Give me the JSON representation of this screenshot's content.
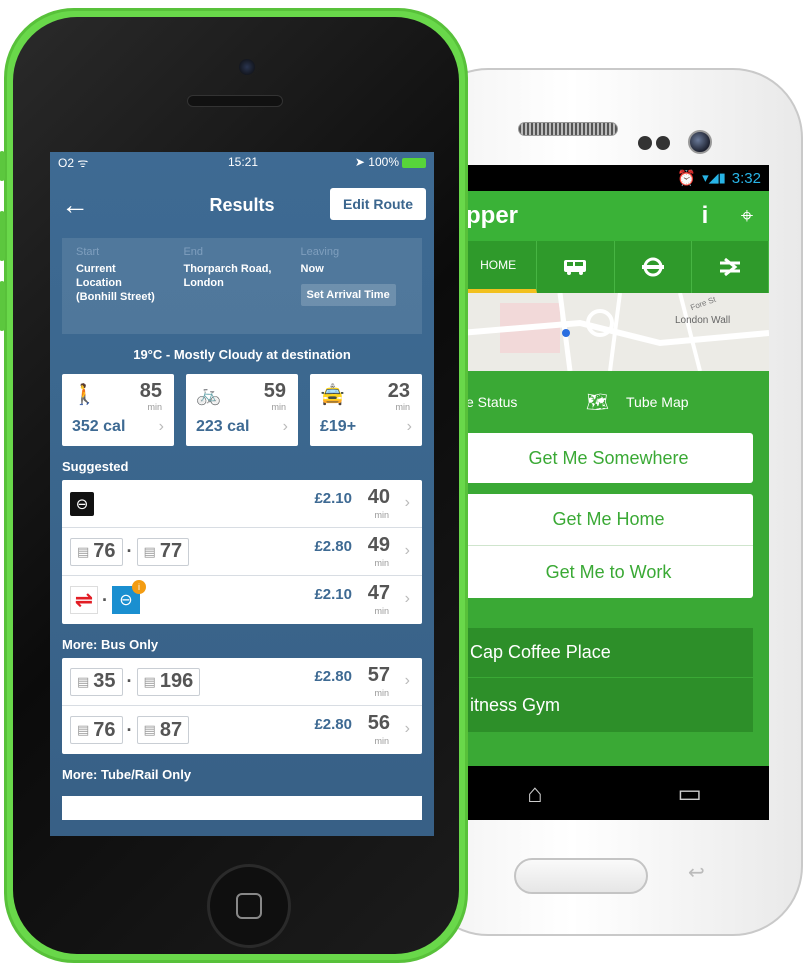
{
  "android": {
    "status": {
      "time": "3:32"
    },
    "header": {
      "title": "pper",
      "info_icon": "info-icon",
      "locate_icon": "crosshair-icon"
    },
    "tabs": [
      {
        "label": "HOME",
        "icon": ""
      },
      {
        "label": "",
        "icon": "bus-icon"
      },
      {
        "label": "",
        "icon": "tube-icon"
      },
      {
        "label": "",
        "icon": "rail-icon"
      }
    ],
    "map": {
      "label": "London Wall",
      "street": "Fore St"
    },
    "links": {
      "status": "e Status",
      "tube_map": "Tube Map"
    },
    "buttons": {
      "somewhere": "Get Me Somewhere",
      "home": "Get Me Home",
      "work": "Get Me to Work"
    },
    "favourites": [
      "Cap Coffee Place",
      "itness Gym"
    ]
  },
  "iphone": {
    "status": {
      "carrier": "O2 ᯤ",
      "time": "15:21",
      "battery": "➤ 100%"
    },
    "nav": {
      "title": "Results",
      "edit": "Edit Route"
    },
    "trip": {
      "start_label": "Start",
      "start_value": [
        "Current",
        "Location",
        "(Bonhill Street)"
      ],
      "end_label": "End",
      "end_value": [
        "Thorparch Road,",
        "London"
      ],
      "leaving_label": "Leaving",
      "leaving_value": "Now",
      "arrival_button": "Set Arrival Time"
    },
    "weather": "19°C - Mostly Cloudy at destination",
    "modes": [
      {
        "icon": "walk-icon",
        "glyph": "🚶",
        "minutes": "85",
        "unit": "min",
        "sub": "352 cal"
      },
      {
        "icon": "bike-icon",
        "glyph": "🚲",
        "minutes": "59",
        "unit": "min",
        "sub": "223 cal"
      },
      {
        "icon": "taxi-icon",
        "glyph": "🚖",
        "minutes": "23",
        "unit": "min",
        "sub": "£19+"
      }
    ],
    "sections": {
      "suggested": "Suggested",
      "bus_only": "More: Bus Only",
      "tube_rail": "More: Tube/Rail Only"
    },
    "suggested": [
      {
        "price": "£2.10",
        "minutes": "40",
        "unit": "min"
      },
      {
        "bus1": "76",
        "bus2": "77",
        "price": "£2.80",
        "minutes": "49",
        "unit": "min"
      },
      {
        "price": "£2.10",
        "minutes": "47",
        "unit": "min"
      }
    ],
    "bus_only": [
      {
        "bus1": "35",
        "bus2": "196",
        "price": "£2.80",
        "minutes": "57",
        "unit": "min"
      },
      {
        "bus1": "76",
        "bus2": "87",
        "price": "£2.80",
        "minutes": "56",
        "unit": "min"
      }
    ]
  }
}
